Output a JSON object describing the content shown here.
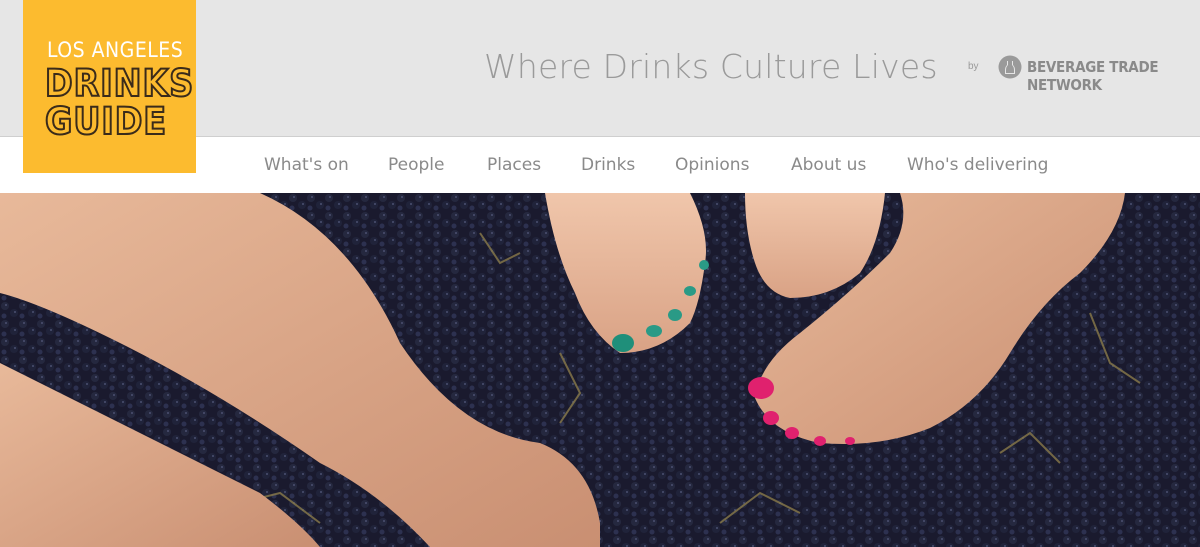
{
  "logo": {
    "line1": "LOS ANGELES",
    "line2": "DRINKS",
    "line3": "GUIDE"
  },
  "header": {
    "tagline": "Where Drinks Culture Lives",
    "by": "by",
    "partner": "BEVERAGE TRADE NETWORK"
  },
  "nav": {
    "items": [
      "What's on",
      "People",
      "Places",
      "Drinks",
      "Opinions",
      "About us",
      "Who's delivering"
    ]
  },
  "colors": {
    "brand": "#fcbb2f",
    "header_bg": "#e6e6e6",
    "nav_text": "#8a8a8a"
  },
  "hero": {
    "image": "feet-stomping-grapes"
  }
}
